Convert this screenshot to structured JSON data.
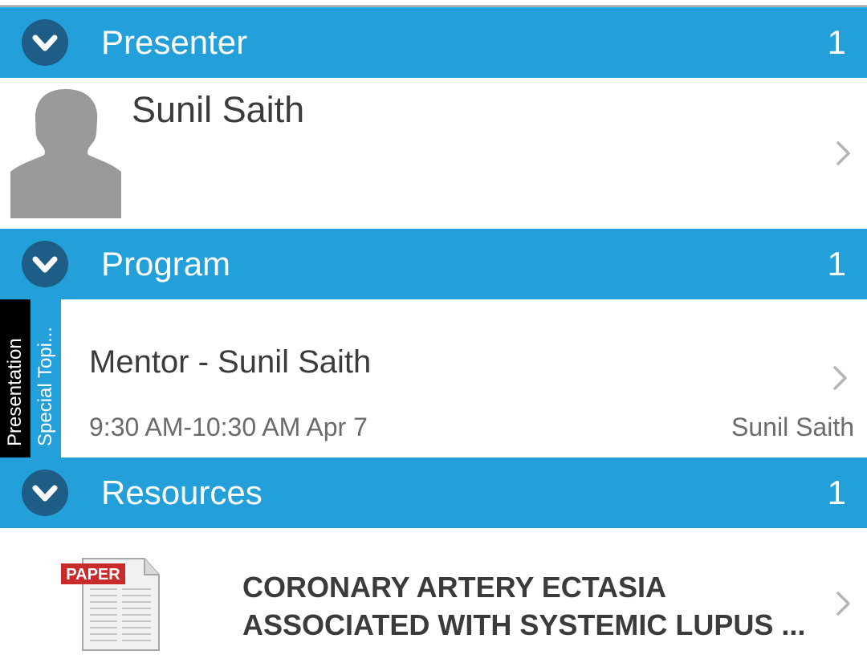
{
  "sections": {
    "presenter": {
      "title": "Presenter",
      "count": "1"
    },
    "program": {
      "title": "Program",
      "count": "1"
    },
    "resources": {
      "title": "Resources",
      "count": "1"
    }
  },
  "presenter": {
    "name": "Sunil Saith"
  },
  "program": {
    "tag_type": "Presentation",
    "tag_track": "Special Topi...",
    "title": "Mentor - Sunil Saith",
    "time": "9:30 AM-10:30 AM  Apr 7",
    "presenter": "Sunil Saith"
  },
  "resource": {
    "icon_label": "PAPER",
    "title_line1": "CORONARY ARTERY ECTASIA",
    "title_line2": "ASSOCIATED WITH SYSTEMIC LUPUS ..."
  },
  "colors": {
    "header_bg": "#239fda",
    "chevron_circle": "#1d5d86",
    "tag_black": "#000000",
    "text_dark": "#3b3b3b",
    "text_muted": "#6b6b6b",
    "paper_red": "#c92a2a"
  },
  "icons": [
    "chevron-down-circle-icon",
    "chevron-right-icon",
    "avatar-silhouette-icon",
    "paper-document-icon"
  ]
}
